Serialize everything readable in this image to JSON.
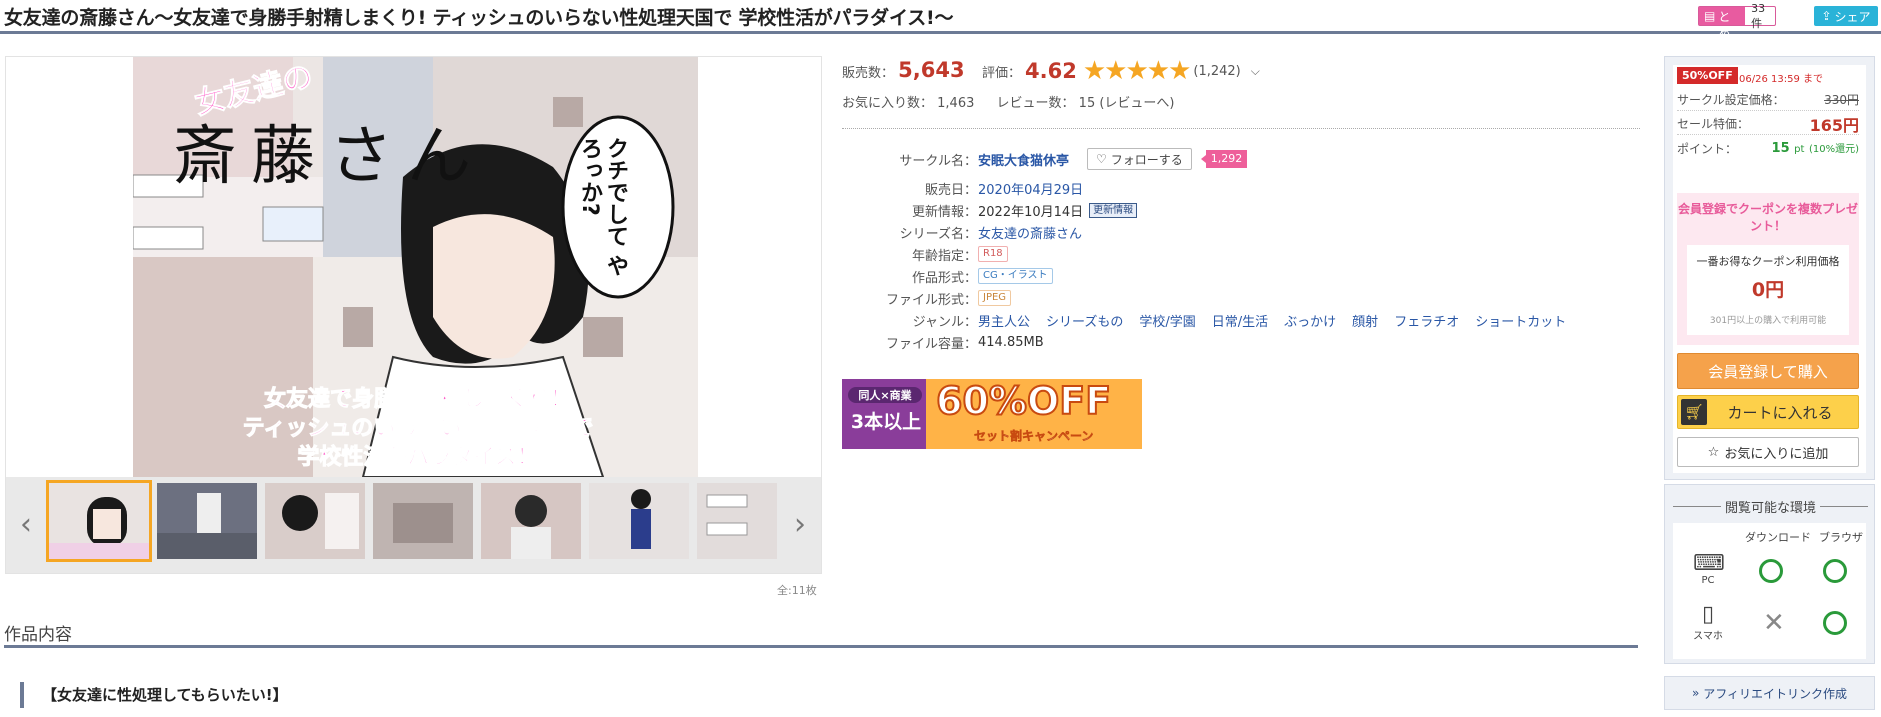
{
  "header": {
    "title": "女友達の斎藤さん～女友達で身勝手射精しまくり! ティッシュのいらない性処理天国で 学校性活がパラダイス!～",
    "matome_label": "まとめ",
    "matome_count": "33件",
    "share_label": "シェア"
  },
  "gallery": {
    "cover_text": {
      "logo_small": "女友達の",
      "logo_big": "斎藤さん",
      "speech": "クチでして やろっか?",
      "bottom_line1": "女友達で身勝手射精しまくり！",
      "bottom_line2": "ティッシュのいらない性処理天国で",
      "bottom_line3": "学校性活がパラダイス！"
    },
    "image_count": "全:11枚"
  },
  "stats": {
    "sales_label": "販売数：",
    "sales_value": "5,643",
    "rating_label": "評価：",
    "rating_value": "4.62",
    "stars": "★★★★★",
    "rating_count": "(1,242)",
    "favorites_label": "お気に入り数：",
    "favorites_value": "1,463",
    "reviews_label": "レビュー数：",
    "reviews_value": "15 (レビューへ)"
  },
  "specs": {
    "circle_label": "サークル名",
    "circle_value": "安眠大食猫休亭",
    "follow_label": "フォローする",
    "follow_count": "1,292",
    "release_label": "販売日",
    "release_value": "2020年04月29日",
    "update_label": "更新情報",
    "update_value": "2022年10月14日",
    "update_tag": "更新情報",
    "series_label": "シリーズ名",
    "series_value": "女友達の斎藤さん",
    "age_label": "年齢指定",
    "age_value": "R18",
    "format_label": "作品形式",
    "format_value": "CG・イラスト",
    "file_label": "ファイル形式",
    "file_value": "JPEG",
    "genre_label": "ジャンル",
    "genres": [
      "男主人公",
      "シリーズもの",
      "学校/学園",
      "日常/生活",
      "ぶっかけ",
      "顔射",
      "フェラチオ",
      "ショートカット"
    ],
    "size_label": "ファイル容量",
    "size_value": "414.85MB"
  },
  "banner": {
    "line1": "同人×商業",
    "line2": "3本以上",
    "big": "60%OFF",
    "sub": "セット割キャンペーン"
  },
  "section": {
    "title": "作品内容",
    "subheading": "【女友達に性処理してもらいたい!】"
  },
  "sidebar": {
    "off_badge": "50%OFF",
    "sale_end": "06/26 13:59 まで",
    "list_price_label": "サークル設定価格：",
    "list_price": "330円",
    "sale_price_label": "セール特価：",
    "sale_price": "165円",
    "point_label": "ポイント：",
    "point_value": "15",
    "point_unit": "pt",
    "point_rate": "(10%還元)",
    "coupon_promo": "会員登録でクーポンを複数プレゼント！",
    "coupon_label": "一番お得なクーポン利用価格",
    "coupon_amount": "0円",
    "coupon_note": "301円以上の購入で利用可能",
    "buy_label": "会員登録して購入",
    "cart_label": "カートに入れる",
    "fav_label": "お気に入りに追加"
  },
  "environment": {
    "title": "閲覧可能な環境",
    "col_download": "ダウンロード",
    "col_browser": "ブラウザ",
    "row_pc": "PC",
    "row_smartphone": "スマホ"
  },
  "affiliate": {
    "label": "アフィリエイトリンク作成"
  },
  "colors": {
    "accent_red": "#c0392b",
    "nav_rule": "#6c7a95",
    "pink": "#e85ba0",
    "star": "#f5a623",
    "ok_green": "#2a9a3a"
  }
}
